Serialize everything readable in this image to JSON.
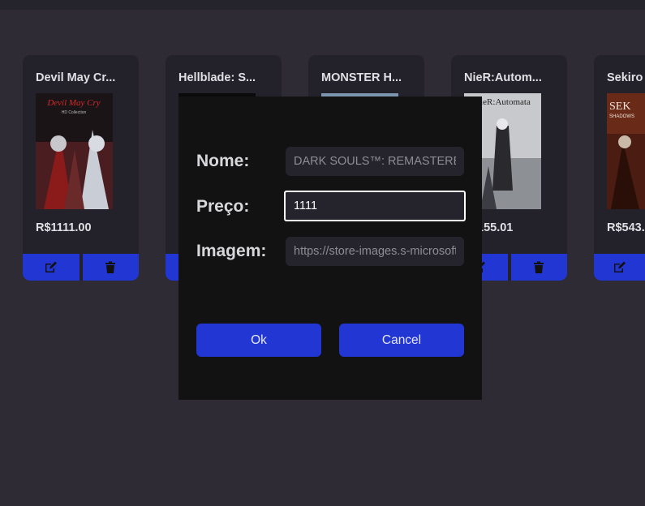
{
  "cards": [
    {
      "title": "Devil May Cr...",
      "price": "R$1111.00",
      "cover_text": "Devil May Cry",
      "cover_sub": "HD Collection"
    },
    {
      "title": "Hellblade: S...",
      "price": "",
      "cover_text": "",
      "cover_sub": ""
    },
    {
      "title": "MONSTER H...",
      "price": "",
      "cover_text": "",
      "cover_sub": ""
    },
    {
      "title": "NieR:Autom...",
      "price": "155.01",
      "cover_text": "NieR:Automata",
      "cover_sub": ""
    },
    {
      "title": "Sekiro",
      "price": "R$543.",
      "cover_text": "SEK",
      "cover_sub": "SHADOWS"
    }
  ],
  "icons": {
    "edit": "edit-icon",
    "delete": "trash-icon"
  },
  "modal": {
    "name_label": "Nome:",
    "name_placeholder": "DARK SOULS™: REMASTERED",
    "price_label": "Preço:",
    "price_value": "1111",
    "image_label": "Imagem:",
    "image_placeholder": "https://store-images.s-microsoft.com",
    "ok_label": "Ok",
    "cancel_label": "Cancel"
  },
  "colors": {
    "background": "#2e2b35",
    "card": "#23212a",
    "accent": "#2236d4",
    "modal": "#121212"
  }
}
